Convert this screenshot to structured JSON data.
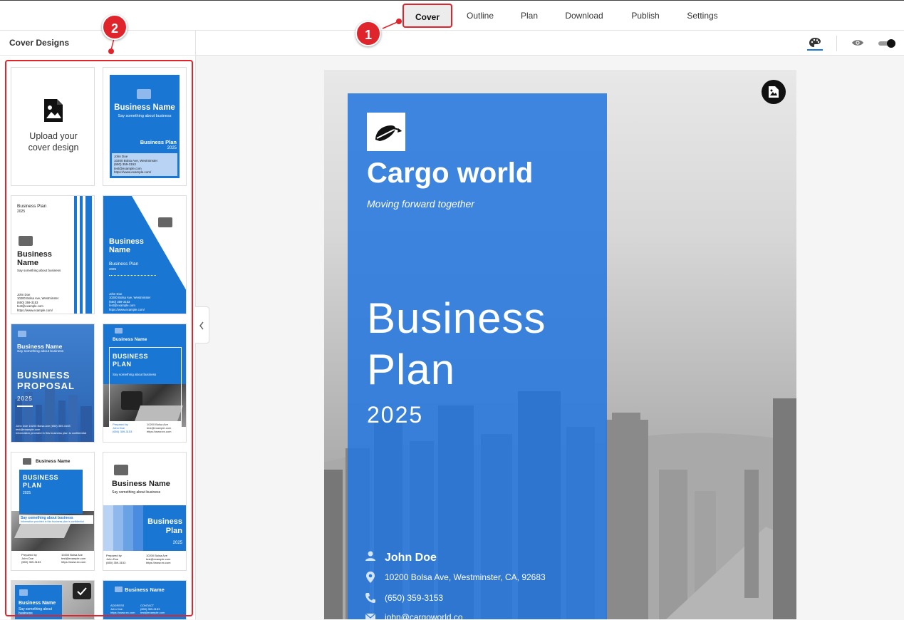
{
  "tabs": [
    {
      "label": "Cover",
      "active": true
    },
    {
      "label": "Outline"
    },
    {
      "label": "Plan"
    },
    {
      "label": "Download"
    },
    {
      "label": "Publish"
    },
    {
      "label": "Settings"
    }
  ],
  "callouts": [
    "1",
    "2"
  ],
  "sidebar": {
    "title": "Cover Designs",
    "upload": {
      "line1": "Upload your",
      "line2": "cover design",
      "icon": "image-file-icon"
    },
    "templates": {
      "t1": {
        "name": "Business Name",
        "tag": "Say something about business",
        "plan": "Business Plan",
        "year": "2025",
        "contact": [
          "John Doe",
          "10200 Bolsa Ave, Westminster",
          "(650) 359-3153",
          "test@example.com",
          "https://www.example.com/"
        ]
      },
      "t2": {
        "plan": "Business Plan",
        "year": "2025",
        "name1": "Business",
        "name2": "Name",
        "tag": "Say something about business",
        "contact": [
          "John Doe",
          "10200 Bolsa Ave, Westminster",
          "(650) 359-3153",
          "test@example.com",
          "https://www.example.com/"
        ]
      },
      "t3": {
        "name1": "Business",
        "name2": "Name",
        "plan": "Business Plan",
        "year": "2025",
        "contact": [
          "John Doe",
          "10200 Bolsa Ave, Westminster",
          "(650) 359-3153",
          "test@example.com",
          "https://www.example.com/"
        ]
      },
      "t4": {
        "name": "Business Name",
        "tag": "Say something about business",
        "big1": "BUSINESS",
        "big2": "PROPOSAL",
        "year": "2025",
        "contact": "John Doe   10200 Bolsa Ave   (650) 359-3153   test@example.com",
        "note": "Information provided in this business plan is confidential"
      },
      "t5": {
        "name": "Business Name",
        "big1": "BUSINESS",
        "big2": "PLAN",
        "tag": "Say something about business",
        "left": [
          "Prepared by",
          "John Doe",
          "(650) 359-3153"
        ],
        "right": [
          "10200 Bolsa Ave",
          "test@example.com",
          "https://www.ex.com"
        ]
      },
      "t6": {
        "name": "Business Name",
        "big1": "BUSINESS",
        "big2": "PLAN",
        "year": "2025",
        "tag": "Say something about business",
        "note": "Information provided in this business plan is confidential",
        "left": [
          "Prepared by",
          "John Doe",
          "(650) 359-3153"
        ],
        "right": [
          "10200 Bolsa Ave",
          "test@example.com",
          "https://www.ex.com"
        ]
      },
      "t7": {
        "name": "Business Name",
        "tag": "Say something about business",
        "plan1": "Business",
        "plan2": "Plan",
        "year": "2025",
        "left": [
          "Prepared by",
          "John Doe",
          "(650) 359-3153"
        ],
        "right": [
          "10200 Bolsa Ave",
          "test@example.com",
          "https://www.ex.com"
        ]
      },
      "t8": {
        "name": "Business Name",
        "tag1": "Say something about",
        "tag2": "business",
        "selected": true
      },
      "t9": {
        "name": "Business Name",
        "col1": [
          "ADDRESS",
          "John Doe",
          "https://www.ex.com"
        ],
        "col2": [
          "CONTACT",
          "(650) 359-3153",
          "test@example.com"
        ]
      }
    }
  },
  "toolbar": {
    "palette_icon": "palette-icon",
    "preview_icon": "eye-icon",
    "toggle_icon": "toggle-switch-icon"
  },
  "cover": {
    "company": "Cargo world",
    "tagline": "Moving forward together",
    "title1": "Business",
    "title2": "Plan",
    "year": "2025",
    "person": "John Doe",
    "address": "10200 Bolsa Ave, Westminster, CA, 92683",
    "phone": "(650) 359-3153",
    "email": "john@cargoworld.co",
    "colors": {
      "panel": "#2678DE",
      "accent": "#1976D2",
      "callout": "#E0242B"
    }
  }
}
